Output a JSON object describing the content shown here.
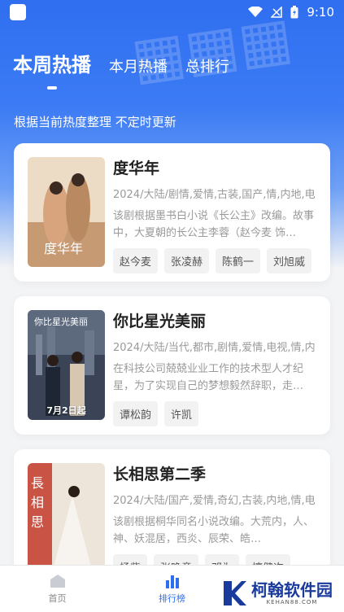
{
  "status": {
    "time": "9:10"
  },
  "tabs": [
    {
      "label": "本周热播",
      "active": true
    },
    {
      "label": "本月热播",
      "active": false
    },
    {
      "label": "总排行",
      "active": false
    }
  ],
  "subtitle": "根据当前热度整理 不定时更新",
  "shows": [
    {
      "title": "度华年",
      "meta": "2024/大陆/剧情,爱情,古装,国产,情,内地,电",
      "desc": "该剧根据墨书白小说《长公主》改编。故事中，大夏朝的长公主李蓉（赵今麦 饰…",
      "cast": [
        "赵今麦",
        "张凌赫",
        "陈鹤一",
        "刘旭威"
      ],
      "poster_text": "",
      "poster_colors": [
        "#e9d9c4",
        "#c89a72",
        "#6e4a3a"
      ]
    },
    {
      "title": "你比星光美丽",
      "meta": "2024/大陆/当代,都市,剧情,爱情,电视,情,内",
      "desc": "在科技公司兢兢业业工作的技术型人才纪星，为了实现自己的梦想毅然辞职，走…",
      "cast": [
        "谭松韵",
        "许凯"
      ],
      "poster_text": "7月2日起",
      "poster_colors": [
        "#26303f",
        "#59667a",
        "#d7c6b0"
      ]
    },
    {
      "title": "长相思第二季",
      "meta": "2024/大陆/国产,爱情,奇幻,古装,内地,情,电",
      "desc": "该剧根据桐华同名小说改编。大荒内，人、神、妖混居，西炎、辰荣、皓…",
      "cast": [
        "杨紫",
        "张晚意",
        "邓为",
        "檀健次"
      ],
      "poster_text": "",
      "poster_colors": [
        "#c23b2a",
        "#e8e0d4",
        "#7a1e14"
      ]
    }
  ],
  "nav": [
    {
      "label": "首页",
      "icon": "home-icon",
      "active": false
    },
    {
      "label": "排行榜",
      "icon": "chart-icon",
      "active": true
    }
  ],
  "watermark": {
    "text": "柯翰软件园",
    "sub": "KEHAN88.COM"
  }
}
